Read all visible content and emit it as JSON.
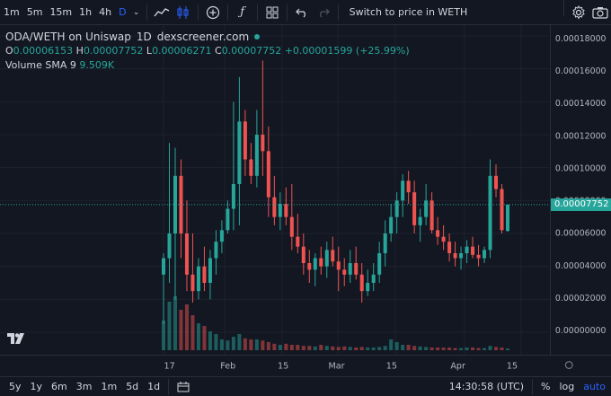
{
  "toolbar": {
    "intervals": [
      "1m",
      "5m",
      "15m",
      "1h",
      "4h",
      "D"
    ],
    "active_interval": "D",
    "switch_label": "Switch to price in WETH"
  },
  "legend": {
    "pair": "ODA/WETH on Uniswap",
    "interval": "1D",
    "source": "dexscreener.com",
    "o_label": "O",
    "o": "0.00006153",
    "h_label": "H",
    "h": "0.00007752",
    "l_label": "L",
    "l": "0.00006271",
    "c_label": "C",
    "c": "0.00007752",
    "change": "+0.00001599 (+25.99%)",
    "volume_label": "Volume",
    "sma_label": "SMA 9",
    "sma_value": "9.509K"
  },
  "current_price": "0.00007752",
  "colors": {
    "up": "#26a69a",
    "down": "#ef5350",
    "bg": "#131722",
    "grid": "#1e222d",
    "accent": "#2962ff"
  },
  "chart_data": {
    "type": "candlestick",
    "y_axis_ticks": [
      "0.00018000",
      "0.00016000",
      "0.00014000",
      "0.00012000",
      "0.00010000",
      "0.00008000",
      "0.00006000",
      "0.00004000",
      "0.00002000",
      "0.00000000"
    ],
    "ylim": [
      0,
      0.00018
    ],
    "x_axis_ticks": [
      "17",
      "Feb",
      "15",
      "Mar",
      "15",
      "Apr",
      "15"
    ],
    "candles": [
      [
        3.5e-05,
        4.8e-05,
        5e-06,
        4.5e-05
      ],
      [
        4.5e-05,
        0.000115,
        3e-05,
        6e-05
      ],
      [
        6e-05,
        0.000112,
        2e-05,
        9.5e-05
      ],
      [
        9.5e-05,
        0.000105,
        4.5e-05,
        6e-05
      ],
      [
        6e-05,
        8e-05,
        2.5e-05,
        3.5e-05
      ],
      [
        3.5e-05,
        6e-05,
        1.8e-05,
        2.5e-05
      ],
      [
        2.5e-05,
        4.5e-05,
        2e-05,
        4e-05
      ],
      [
        4e-05,
        5.2e-05,
        2.5e-05,
        3e-05
      ],
      [
        3e-05,
        5e-05,
        2e-05,
        4.5e-05
      ],
      [
        4.5e-05,
        6.2e-05,
        3.5e-05,
        5.5e-05
      ],
      [
        5.5e-05,
        6.8e-05,
        4.8e-05,
        6.2e-05
      ],
      [
        6.2e-05,
        8e-05,
        6e-05,
        7.5e-05
      ],
      [
        7.5e-05,
        0.00014,
        6.2e-05,
        9e-05
      ],
      [
        9e-05,
        0.000155,
        6.5e-05,
        0.000128
      ],
      [
        0.000128,
        0.000135,
        9.5e-05,
        0.000105
      ],
      [
        0.000105,
        0.000115,
        9e-05,
        9.5e-05
      ],
      [
        9.5e-05,
        0.000135,
        8.8e-05,
        0.00012
      ],
      [
        0.00012,
        0.000165,
        9.5e-05,
        0.00011
      ],
      [
        0.00011,
        0.000125,
        7e-05,
        8.2e-05
      ],
      [
        8.2e-05,
        9.5e-05,
        6.5e-05,
        7e-05
      ],
      [
        7e-05,
        8.5e-05,
        6.2e-05,
        7.8e-05
      ],
      [
        7.8e-05,
        8.8e-05,
        6.5e-05,
        7e-05
      ],
      [
        7e-05,
        9e-05,
        5e-05,
        5.8e-05
      ],
      [
        5.8e-05,
        7.2e-05,
        4.8e-05,
        5.2e-05
      ],
      [
        5.2e-05,
        6e-05,
        3.5e-05,
        4.2e-05
      ],
      [
        4.2e-05,
        5e-05,
        3e-05,
        3.8e-05
      ],
      [
        3.8e-05,
        4.8e-05,
        2.8e-05,
        4.5e-05
      ],
      [
        4.5e-05,
        5.2e-05,
        3.5e-05,
        4e-05
      ],
      [
        4e-05,
        5.5e-05,
        3.3e-05,
        5e-05
      ],
      [
        5e-05,
        5.8e-05,
        4e-05,
        4.3e-05
      ],
      [
        4.3e-05,
        5.2e-05,
        2.5e-05,
        3.8e-05
      ],
      [
        3.8e-05,
        4.5e-05,
        2.8e-05,
        3.5e-05
      ],
      [
        3.5e-05,
        5e-05,
        3e-05,
        4.2e-05
      ],
      [
        4.2e-05,
        5.2e-05,
        3.2e-05,
        3.5e-05
      ],
      [
        3.5e-05,
        4.2e-05,
        1.8e-05,
        2.5e-05
      ],
      [
        2.5e-05,
        3.8e-05,
        2.2e-05,
        3e-05
      ],
      [
        3e-05,
        4.2e-05,
        2.5e-05,
        3.5e-05
      ],
      [
        3.5e-05,
        5.5e-05,
        3e-05,
        4.8e-05
      ],
      [
        4.8e-05,
        6.8e-05,
        4e-05,
        6e-05
      ],
      [
        6e-05,
        7.8e-05,
        5.5e-05,
        7e-05
      ],
      [
        7e-05,
        8.5e-05,
        6e-05,
        8e-05
      ],
      [
        8e-05,
        9.6e-05,
        7e-05,
        9.2e-05
      ],
      [
        9.2e-05,
        9.8e-05,
        7.8e-05,
        8.5e-05
      ],
      [
        8.5e-05,
        9.2e-05,
        6e-05,
        6.5e-05
      ],
      [
        6.5e-05,
        7.5e-05,
        5.5e-05,
        7e-05
      ],
      [
        7e-05,
        9e-05,
        6.5e-05,
        8e-05
      ],
      [
        8e-05,
        8.5e-05,
        6e-05,
        6.2e-05
      ],
      [
        6.2e-05,
        7e-05,
        5.3e-05,
        5.8e-05
      ],
      [
        5.8e-05,
        6.5e-05,
        5e-05,
        5.5e-05
      ],
      [
        5.5e-05,
        6e-05,
        4.3e-05,
        4.8e-05
      ],
      [
        4.8e-05,
        5.5e-05,
        4e-05,
        4.5e-05
      ],
      [
        4.5e-05,
        5.2e-05,
        3.8e-05,
        4.8e-05
      ],
      [
        4.8e-05,
        5.6e-05,
        4.2e-05,
        5.2e-05
      ],
      [
        5.2e-05,
        5.8e-05,
        4.5e-05,
        4.7e-05
      ],
      [
        4.7e-05,
        5.3e-05,
        4e-05,
        4.5e-05
      ],
      [
        4.5e-05,
        5.2e-05,
        4.2e-05,
        5e-05
      ],
      [
        5e-05,
        0.000105,
        4.5e-05,
        9.5e-05
      ],
      [
        9.5e-05,
        0.000102,
        8.2e-05,
        8.7e-05
      ],
      [
        8.7e-05,
        9e-05,
        6e-05,
        6.2e-05
      ],
      [
        6.15e-05,
        7.75e-05,
        6.1e-05,
        7.75e-05
      ]
    ],
    "volumes": [
      0.55,
      0.9,
      1.0,
      0.75,
      0.85,
      0.65,
      0.5,
      0.45,
      0.35,
      0.3,
      0.2,
      0.18,
      0.25,
      0.3,
      0.22,
      0.2,
      0.2,
      0.18,
      0.15,
      0.12,
      0.1,
      0.12,
      0.1,
      0.1,
      0.08,
      0.08,
      0.07,
      0.1,
      0.08,
      0.07,
      0.06,
      0.07,
      0.06,
      0.05,
      0.06,
      0.05,
      0.05,
      0.06,
      0.08,
      0.2,
      0.15,
      0.1,
      0.1,
      0.08,
      0.07,
      0.06,
      0.05,
      0.05,
      0.05,
      0.05,
      0.04,
      0.04,
      0.05,
      0.05,
      0.04,
      0.04,
      0.08,
      0.06,
      0.05,
      0.03
    ]
  },
  "bottom_bar": {
    "ranges": [
      "5y",
      "1y",
      "6m",
      "3m",
      "1m",
      "5d",
      "1d"
    ],
    "time": "14:30:58 (UTC)",
    "percent": "%",
    "log": "log",
    "auto": "auto"
  }
}
